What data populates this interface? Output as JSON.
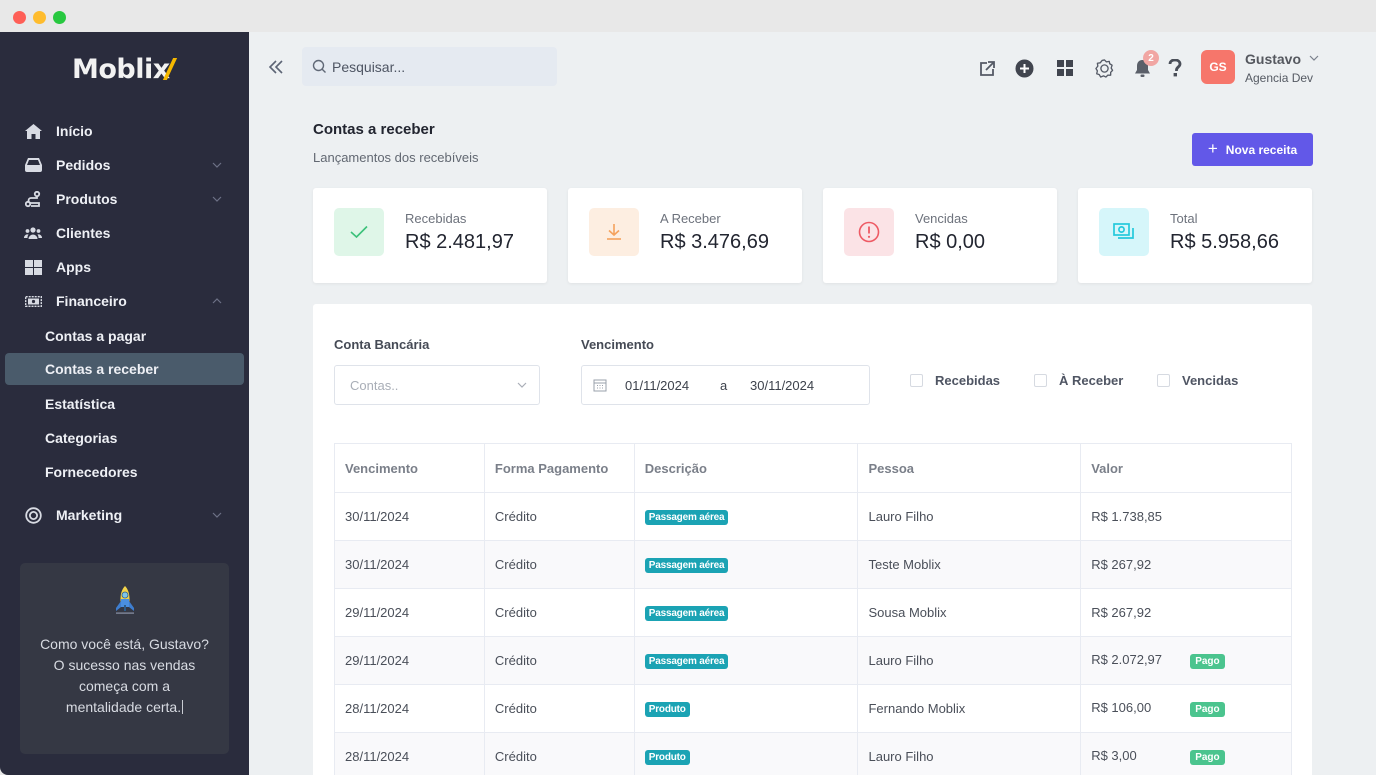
{
  "brand": {
    "name_main": "Mobli",
    "name_x": "x"
  },
  "sidebar": {
    "items": [
      {
        "label": "Início",
        "icon": "home-icon",
        "expandable": false
      },
      {
        "label": "Pedidos",
        "icon": "inbox-icon",
        "expandable": true,
        "expanded": false
      },
      {
        "label": "Produtos",
        "icon": "route-icon",
        "expandable": true,
        "expanded": false
      },
      {
        "label": "Clientes",
        "icon": "users-icon",
        "expandable": false
      },
      {
        "label": "Apps",
        "icon": "grid-icon",
        "expandable": false
      },
      {
        "label": "Financeiro",
        "icon": "money-icon",
        "expandable": true,
        "expanded": true
      },
      {
        "label": "Marketing",
        "icon": "target-icon",
        "expandable": true,
        "expanded": false
      }
    ],
    "financeiro_sub": [
      {
        "label": "Contas a pagar",
        "active": false
      },
      {
        "label": "Contas a receber",
        "active": true
      },
      {
        "label": "Estatística",
        "active": false
      },
      {
        "label": "Categorias",
        "active": false
      },
      {
        "label": "Fornecedores",
        "active": false
      }
    ],
    "promo": {
      "icon": "rocket-icon",
      "line1": "Como você está, Gustavo?",
      "line2": "O sucesso nas vendas",
      "line3": "começa com a",
      "line4": "mentalidade certa."
    }
  },
  "topbar": {
    "search_placeholder": "Pesquisar...",
    "notifications_count": "2",
    "user": {
      "initials": "GS",
      "name": "Gustavo",
      "org": "Agencia Dev"
    },
    "icons": [
      "external-link-icon",
      "plus-circle-icon",
      "grid-icon",
      "gear-icon",
      "bell-icon",
      "help-icon"
    ]
  },
  "page": {
    "title": "Contas a receber",
    "subtitle": "Lançamentos dos recebíveis",
    "new_button": "Nova receita"
  },
  "stats": [
    {
      "label": "Recebidas",
      "value": "R$ 2.481,97",
      "icon": "check-icon",
      "color": "#3cc17a",
      "bg": "#dff6e8"
    },
    {
      "label": "A Receber",
      "value": "R$ 3.476,69",
      "icon": "download-icon",
      "color": "#f5a25d",
      "bg": "#fdeee1"
    },
    {
      "label": "Vencidas",
      "value": "R$ 0,00",
      "icon": "alert-circle-icon",
      "color": "#ee5a64",
      "bg": "#fbe3e6"
    },
    {
      "label": "Total",
      "value": "R$ 5.958,66",
      "icon": "cash-icon",
      "color": "#24c9dc",
      "bg": "#d6f6fa"
    }
  ],
  "filters": {
    "account_label": "Conta Bancária",
    "account_placeholder": "Contas..",
    "due_label": "Vencimento",
    "date_from": "01/11/2024",
    "date_sep": "a",
    "date_to": "30/11/2024",
    "checkboxes": [
      {
        "label": "Recebidas",
        "checked": false
      },
      {
        "label": "À Receber",
        "checked": false
      },
      {
        "label": "Vencidas",
        "checked": false
      }
    ]
  },
  "table": {
    "columns": [
      "Vencimento",
      "Forma Pagamento",
      "Descrição",
      "Pessoa",
      "Valor"
    ],
    "rows": [
      {
        "due": "30/11/2024",
        "method": "Crédito",
        "desc": "Passagem aérea",
        "person": "Lauro Filho",
        "value": "R$ 1.738,85",
        "status": ""
      },
      {
        "due": "30/11/2024",
        "method": "Crédito",
        "desc": "Passagem aérea",
        "person": "Teste Moblix",
        "value": "R$ 267,92",
        "status": ""
      },
      {
        "due": "29/11/2024",
        "method": "Crédito",
        "desc": "Passagem aérea",
        "person": "Sousa Moblix",
        "value": "R$ 267,92",
        "status": ""
      },
      {
        "due": "29/11/2024",
        "method": "Crédito",
        "desc": "Passagem aérea",
        "person": "Lauro Filho",
        "value": "R$ 2.072,97",
        "status": "Pago"
      },
      {
        "due": "28/11/2024",
        "method": "Crédito",
        "desc": "Produto",
        "person": "Fernando Moblix",
        "value": "R$ 106,00",
        "status": "Pago"
      },
      {
        "due": "28/11/2024",
        "method": "Crédito",
        "desc": "Produto",
        "person": "Lauro Filho",
        "value": "R$ 3,00",
        "status": "Pago"
      }
    ]
  },
  "colors": {
    "accent": "#6258e8",
    "sidebar_bg": "#2a2c3d",
    "active_item": "#4a5b6b",
    "tag": "#1ba3b4",
    "paid": "#4bc48e"
  }
}
